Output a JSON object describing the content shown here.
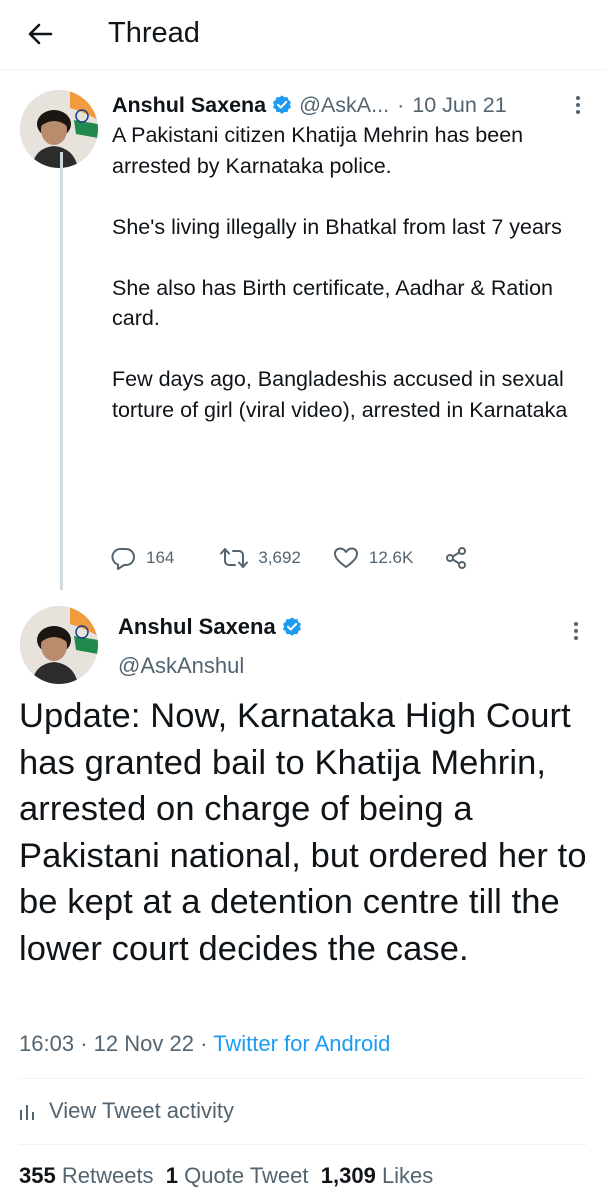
{
  "header": {
    "title": "Thread"
  },
  "tweet1": {
    "author_name": "Anshul Saxena",
    "handle": "@AskA...",
    "separator": "·",
    "date": "10 Jun 21",
    "paragraphs": [
      "A Pakistani citizen Khatija Mehrin has been arrested by Karnataka police.",
      "She's living illegally in Bhatkal from last 7 years",
      "She also has Birth certificate, Aadhar & Ration card.",
      "Few days ago, Bangladeshis accused in sexual torture of girl (viral video), arrested in Karnataka"
    ],
    "replies": "164",
    "retweets": "3,692",
    "likes": "12.6K"
  },
  "tweet2": {
    "author_name": "Anshul Saxena",
    "handle": "@AskAnshul",
    "text": "Update: Now, Karnataka High Court has granted bail to Khatija Mehrin, arrested on charge of being a Pakistani national, but ordered her to be kept at a detention centre till the lower court decides the case.",
    "time": "16:03",
    "sep1": "·",
    "date": "12 Nov 22",
    "sep2": "·",
    "source": "Twitter for Android",
    "activity_label": "View Tweet activity",
    "retweets_count": "355",
    "retweets_label": "Retweets",
    "quotes_count": "1",
    "quotes_label": "Quote Tweet",
    "likes_count": "1,309",
    "likes_label": "Likes"
  },
  "icons": {
    "back": "arrow-left-icon",
    "verified": "verified-badge-icon",
    "more": "more-vertical-icon",
    "reply": "reply-icon",
    "retweet": "retweet-icon",
    "like": "heart-icon",
    "share": "share-icon",
    "activity": "bar-chart-icon"
  },
  "colors": {
    "accent": "#1d9bf0",
    "text": "#0f1419",
    "secondary": "#536471",
    "divider": "#eff3f4"
  }
}
